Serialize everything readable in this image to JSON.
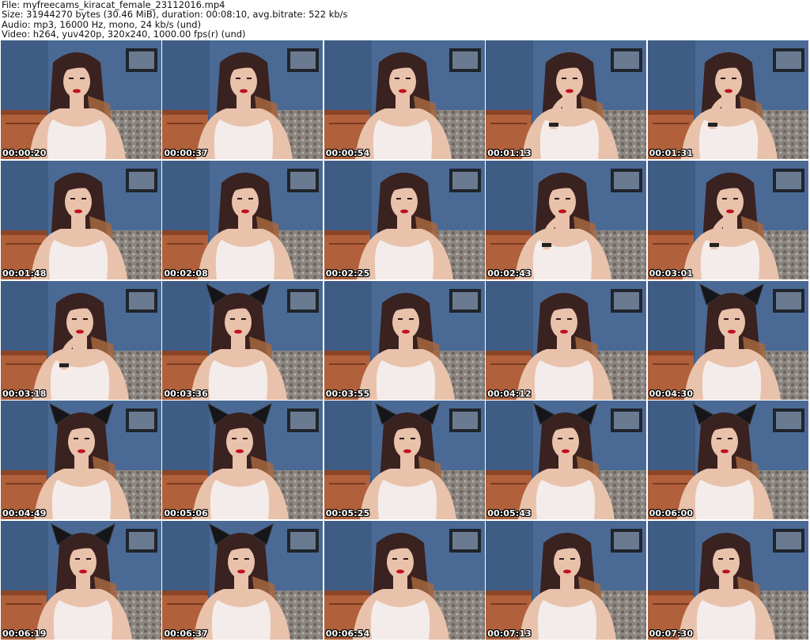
{
  "header": {
    "file_line": "File: myfreecams_kiracat_female_23112016.mp4",
    "size_line": "Size: 31944270 bytes (30.46 MiB), duration: 00:08:10, avg.bitrate: 522 kb/s",
    "audio_line": "Audio: mp3, 16000 Hz, mono, 24 kb/s (und)",
    "video_line": "Video: h264, yuv420p, 320x240, 1000.00 fps(r) (und)"
  },
  "thumbnails": [
    {
      "timestamp": "00:00:20",
      "ears": false,
      "hand": false
    },
    {
      "timestamp": "00:00:37",
      "ears": false,
      "hand": false
    },
    {
      "timestamp": "00:00:54",
      "ears": false,
      "hand": false
    },
    {
      "timestamp": "00:01:13",
      "ears": false,
      "hand": true
    },
    {
      "timestamp": "00:01:31",
      "ears": false,
      "hand": true
    },
    {
      "timestamp": "00:01:48",
      "ears": false,
      "hand": false
    },
    {
      "timestamp": "00:02:08",
      "ears": false,
      "hand": false
    },
    {
      "timestamp": "00:02:25",
      "ears": false,
      "hand": false
    },
    {
      "timestamp": "00:02:43",
      "ears": false,
      "hand": true
    },
    {
      "timestamp": "00:03:01",
      "ears": false,
      "hand": true
    },
    {
      "timestamp": "00:03:18",
      "ears": false,
      "hand": true
    },
    {
      "timestamp": "00:03:36",
      "ears": true,
      "hand": false
    },
    {
      "timestamp": "00:03:55",
      "ears": false,
      "hand": false
    },
    {
      "timestamp": "00:04:12",
      "ears": false,
      "hand": false
    },
    {
      "timestamp": "00:04:30",
      "ears": true,
      "hand": false
    },
    {
      "timestamp": "00:04:49",
      "ears": true,
      "hand": false
    },
    {
      "timestamp": "00:05:06",
      "ears": true,
      "hand": false
    },
    {
      "timestamp": "00:05:25",
      "ears": true,
      "hand": false
    },
    {
      "timestamp": "00:05:43",
      "ears": true,
      "hand": false
    },
    {
      "timestamp": "00:06:00",
      "ears": true,
      "hand": false
    },
    {
      "timestamp": "00:06:19",
      "ears": true,
      "hand": false
    },
    {
      "timestamp": "00:06:37",
      "ears": true,
      "hand": false
    },
    {
      "timestamp": "00:06:54",
      "ears": false,
      "hand": false
    },
    {
      "timestamp": "00:07:13",
      "ears": false,
      "hand": false
    },
    {
      "timestamp": "00:07:30",
      "ears": false,
      "hand": false
    }
  ],
  "colors": {
    "wall": "#4a6a95",
    "skin": "#e9c2ac",
    "hair": "#3a2220",
    "hair_tip": "#a6663f",
    "top": "#f3ecea",
    "lips": "#c01020",
    "furniture": "#b0603a",
    "bedspread": "#8a8580"
  }
}
